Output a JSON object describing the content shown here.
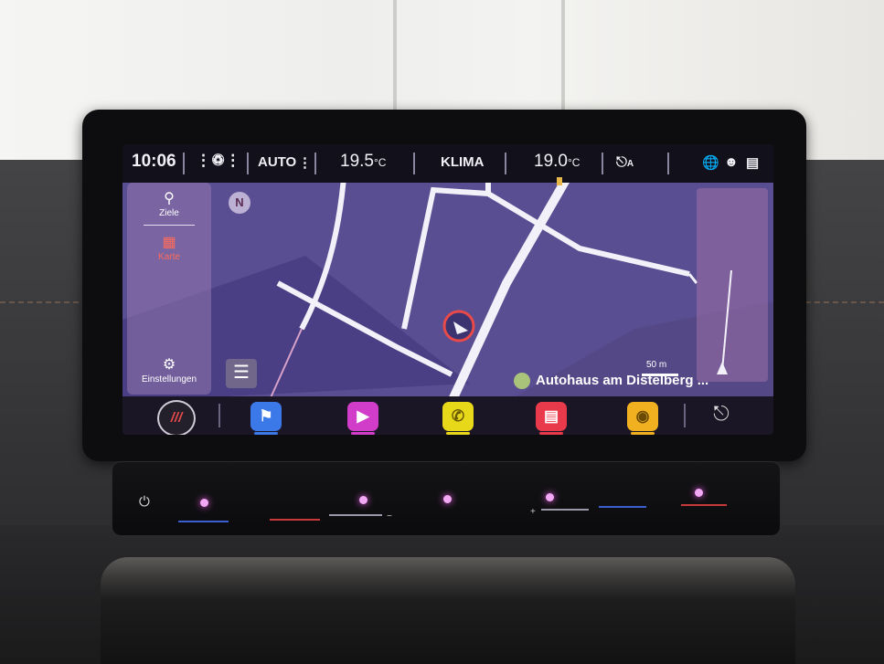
{
  "status_bar": {
    "time": "10:06",
    "climate_mode": "AUTO",
    "left_temp": "19.5",
    "left_temp_unit": "°C",
    "center_label": "KLIMA",
    "right_temp": "19.0",
    "right_temp_unit": "°C",
    "car_mode_suffix": "A"
  },
  "sidebar": {
    "items": [
      {
        "label": "Ziele",
        "icon": "search-icon"
      },
      {
        "label": "Karte",
        "icon": "map-icon"
      },
      {
        "label": "Einstellungen",
        "icon": "gear-icon"
      }
    ]
  },
  "map": {
    "destination": "Autohaus am Distelberg ...",
    "scale_label": "50 m"
  },
  "dock": {
    "apps": [
      {
        "name": "home-button",
        "color": "#d83a3a"
      },
      {
        "name": "navigation-app",
        "color": "#3b78e8"
      },
      {
        "name": "media-app",
        "color": "#d13cc8"
      },
      {
        "name": "phone-app",
        "color": "#e8d81a"
      },
      {
        "name": "radio-app",
        "color": "#e83a4a"
      },
      {
        "name": "apps-app",
        "color": "#f0b020"
      },
      {
        "name": "car-app",
        "color": "#dddddd"
      }
    ]
  },
  "colors": {
    "map_background": "#5a4e93",
    "road": "#f2f0f8",
    "accent_red": "#e84a4a",
    "touch_glow": "#ec5de9"
  }
}
